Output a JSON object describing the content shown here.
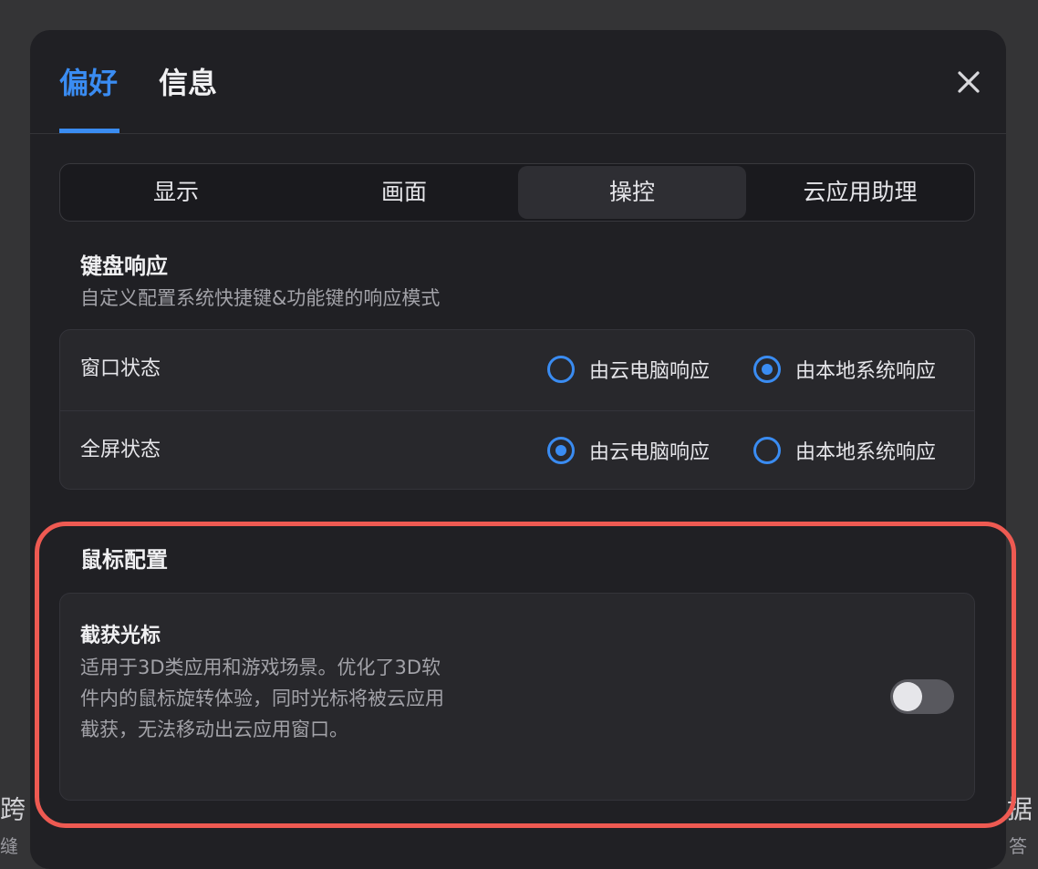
{
  "dialog": {
    "tabs": [
      {
        "label": "偏好",
        "active": true
      },
      {
        "label": "信息",
        "active": false
      }
    ],
    "close_icon": "close-icon"
  },
  "subtabs": [
    {
      "label": "显示",
      "active": false
    },
    {
      "label": "画面",
      "active": false
    },
    {
      "label": "操控",
      "active": true
    },
    {
      "label": "云应用助理",
      "active": false
    }
  ],
  "keyboard": {
    "title": "键盘响应",
    "description": "自定义配置系统快捷键&功能键的响应模式",
    "rows": [
      {
        "label": "窗口状态",
        "options": [
          {
            "label": "由云电脑响应",
            "checked": false
          },
          {
            "label": "由本地系统响应",
            "checked": true
          }
        ]
      },
      {
        "label": "全屏状态",
        "options": [
          {
            "label": "由云电脑响应",
            "checked": true
          },
          {
            "label": "由本地系统响应",
            "checked": false
          }
        ]
      }
    ]
  },
  "mouse": {
    "title": "鼠标配置",
    "capture": {
      "title": "截获光标",
      "description": "适用于3D类应用和游戏场景。优化了3D软件内的鼠标旋转体验，同时光标将被云应用截获，无法移动出云应用窗口。",
      "enabled": false
    }
  },
  "colors": {
    "accent": "#3a8cf2",
    "highlight": "#ee5a52",
    "dialog_bg": "#202024"
  },
  "backdrop": {
    "left_text": "跨",
    "left_sub": "缝",
    "right_text": "据",
    "right_sub": "答"
  }
}
